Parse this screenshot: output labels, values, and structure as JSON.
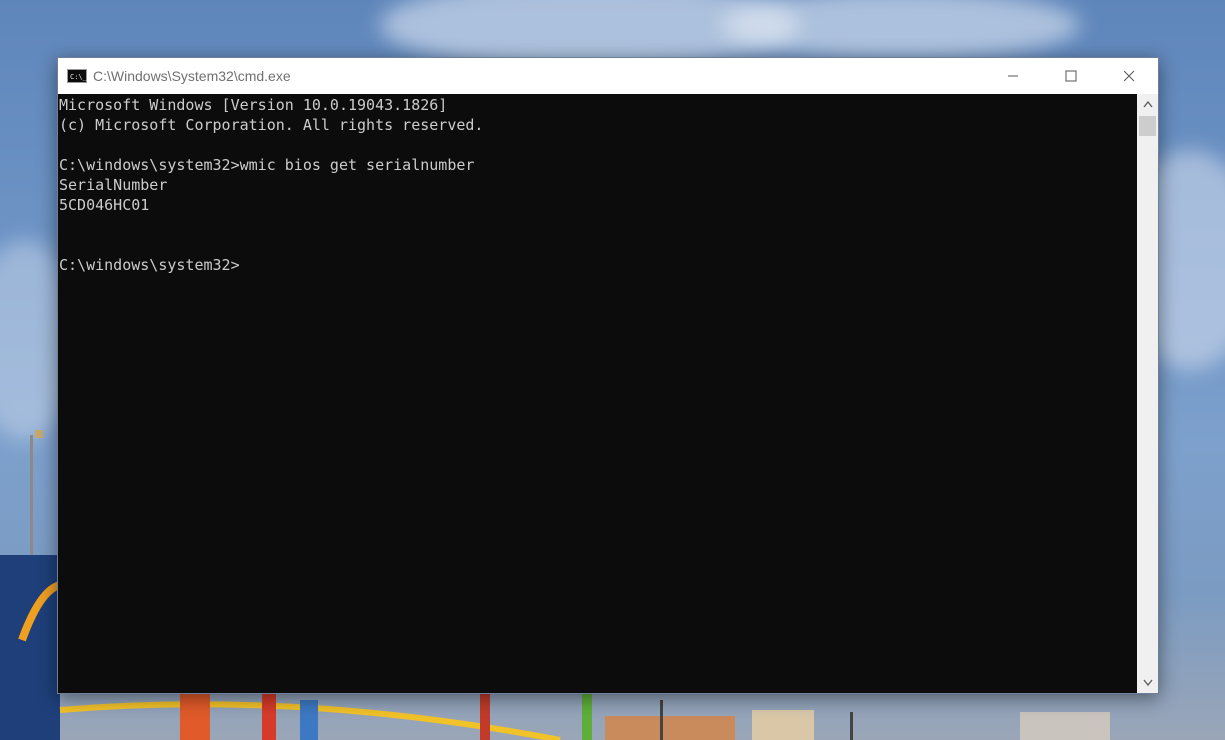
{
  "window": {
    "title": "C:\\Windows\\System32\\cmd.exe",
    "icon_text": "C:\\_"
  },
  "caption": {
    "minimize_icon": "minimize-icon",
    "maximize_icon": "maximize-icon",
    "close_icon": "close-icon"
  },
  "console": {
    "lines": [
      "Microsoft Windows [Version 10.0.19043.1826]",
      "(c) Microsoft Corporation. All rights reserved.",
      "",
      "C:\\windows\\system32>wmic bios get serialnumber",
      "SerialNumber",
      "5CD046HC01",
      "",
      "",
      "C:\\windows\\system32>"
    ]
  },
  "colors": {
    "console_bg": "#0c0c0c",
    "console_fg": "#cccccc",
    "titlebar_bg": "#ffffff"
  }
}
